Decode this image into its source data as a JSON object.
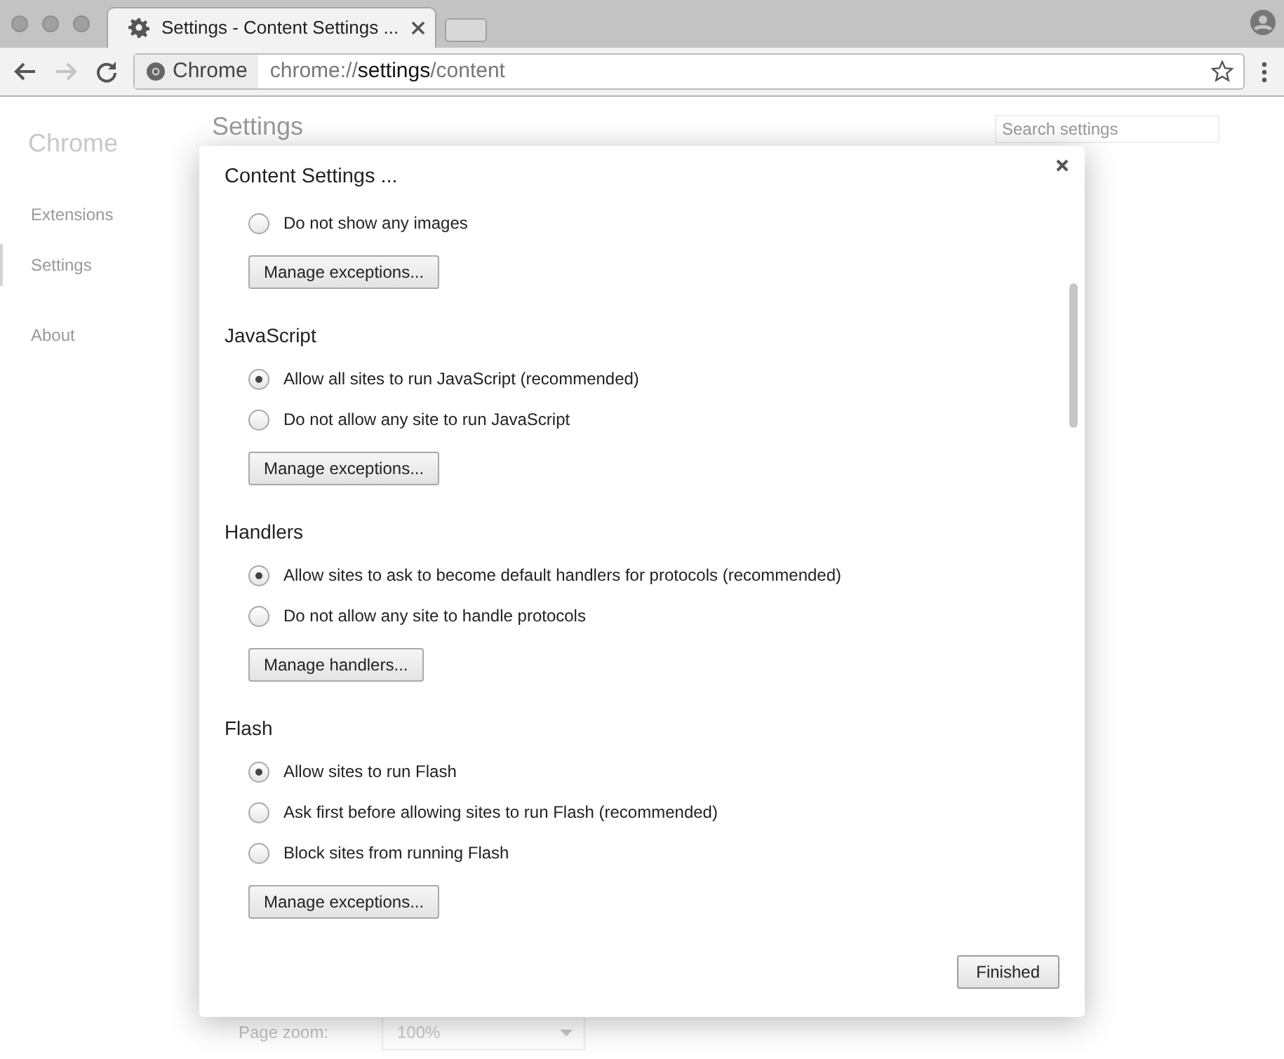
{
  "tab": {
    "title": "Settings - Content Settings ..."
  },
  "toolbar": {
    "buttons": [
      {
        "kind": "back",
        "disabled": false
      },
      {
        "kind": "forward",
        "disabled": true
      },
      {
        "kind": "reload",
        "disabled": false
      }
    ]
  },
  "omnibox": {
    "chip": "Chrome",
    "url": [
      {
        "text": "chrome://",
        "emphasized": false
      },
      {
        "text": "settings",
        "emphasized": true
      },
      {
        "text": "/content",
        "emphasized": false
      }
    ]
  },
  "page": {
    "brand": "Chrome",
    "nav": [
      {
        "label": "Extensions",
        "selected": false
      },
      {
        "label": "Settings",
        "selected": true
      },
      {
        "label": "About",
        "selected": false
      }
    ],
    "heading": "Settings",
    "search": {
      "placeholder": "Search settings"
    },
    "page_zoom": {
      "label": "Page zoom:",
      "value": "100%"
    }
  },
  "dialog": {
    "title": "Content Settings ...",
    "sections": [
      {
        "options": [
          {
            "label": "Do not show any images",
            "selected": false
          }
        ],
        "button": "Manage exceptions..."
      },
      {
        "heading": "JavaScript",
        "options": [
          {
            "label": "Allow all sites to run JavaScript (recommended)",
            "selected": true
          },
          {
            "label": "Do not allow any site to run JavaScript",
            "selected": false
          }
        ],
        "button": "Manage exceptions..."
      },
      {
        "heading": "Handlers",
        "options": [
          {
            "label": "Allow sites to ask to become default handlers for protocols (recommended)",
            "selected": true
          },
          {
            "label": "Do not allow any site to handle protocols",
            "selected": false
          }
        ],
        "button": "Manage handlers..."
      },
      {
        "heading": "Flash",
        "options": [
          {
            "label": "Allow sites to run Flash",
            "selected": true
          },
          {
            "label": "Ask first before allowing sites to run Flash (recommended)",
            "selected": false
          },
          {
            "label": "Block sites from running Flash",
            "selected": false
          }
        ],
        "button": "Manage exceptions..."
      }
    ],
    "finish_button": "Finished"
  }
}
